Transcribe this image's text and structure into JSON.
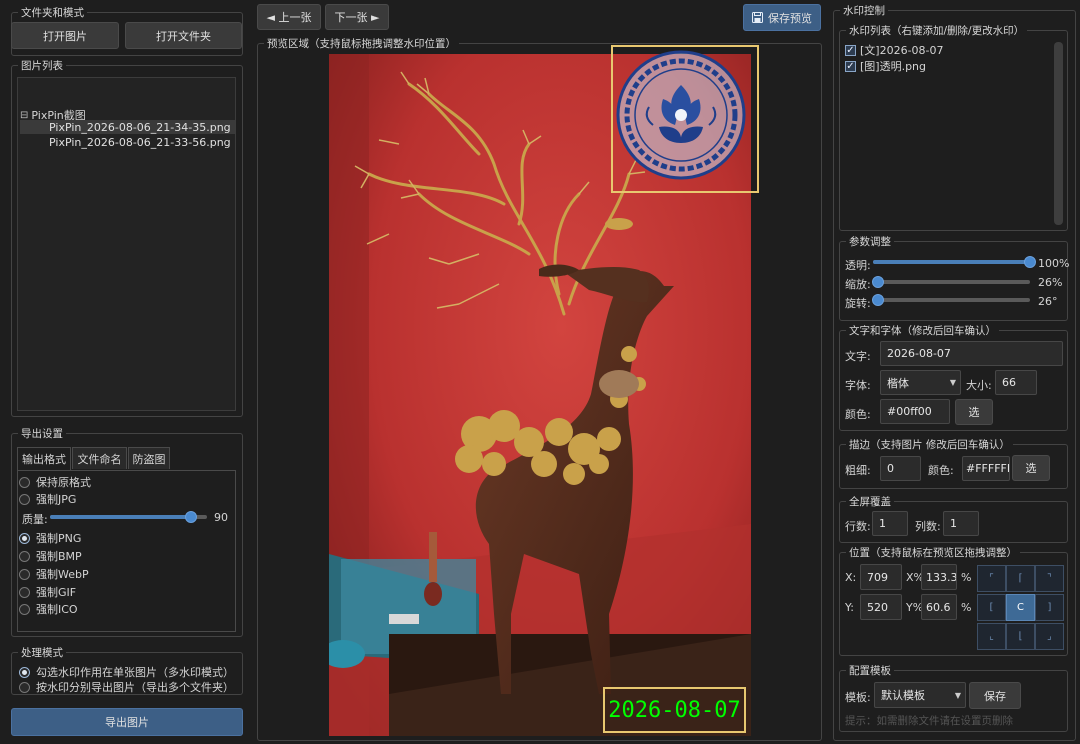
{
  "left": {
    "files_group": {
      "title": "文件夹和模式",
      "open_image": "打开图片",
      "open_folder": "打开文件夹"
    },
    "image_list": {
      "title": "图片列表",
      "folder": "PixPin截图",
      "folder_toggle": "⊟",
      "items": [
        "PixPin_2026-08-06_21-34-35.png",
        "PixPin_2026-08-06_21-33-56.png"
      ]
    },
    "export": {
      "title": "导出设置",
      "tabs": [
        "输出格式",
        "文件命名",
        "防盗图"
      ],
      "formats": [
        "保持原格式",
        "强制JPG",
        "强制PNG",
        "强制BMP",
        "强制WebP",
        "强制GIF",
        "强制ICO"
      ],
      "selected_format": "强制PNG",
      "quality_label": "质量:",
      "quality_value": "90",
      "quality_percent": 90
    },
    "mode": {
      "title": "处理模式",
      "options": [
        "勾选水印作用在单张图片（多水印模式）",
        "按水印分别导出图片（导出多个文件夹）"
      ],
      "selected": 0
    },
    "export_button": "导出图片"
  },
  "center": {
    "prev": "◄ 上一张",
    "next": "下一张 ►",
    "save_preview": "保存预览",
    "preview_title": "预览区域（支持鼠标拖拽调整水印位置）",
    "watermark_text": "2026-08-07",
    "watermark_text_color": "#00ff00"
  },
  "right": {
    "title": "水印控制",
    "wm_list": {
      "title": "水印列表（右键添加/删除/更改水印）",
      "items": [
        {
          "label": "[文]2026-08-07",
          "checked": true
        },
        {
          "label": "[图]透明.png",
          "checked": true
        }
      ]
    },
    "params": {
      "title": "参数调整",
      "opacity_label": "透明:",
      "opacity_value": "100%",
      "opacity_percent": 100,
      "scale_label": "缩放:",
      "scale_value": "26%",
      "scale_percent": 3,
      "rotate_label": "旋转:",
      "rotate_value": "26°",
      "rotate_percent": 3
    },
    "text_font": {
      "title": "文字和字体（修改后回车确认）",
      "text_label": "文字:",
      "text_value": "2026-08-07",
      "font_label": "字体:",
      "font_value": "楷体",
      "size_label": "大小:",
      "size_value": "66",
      "color_label": "颜色:",
      "color_value": "#00ff00",
      "pick_label": "选"
    },
    "stroke": {
      "title": "描边（支持图片 修改后回车确认）",
      "width_label": "粗细:",
      "width_value": "0",
      "color_label": "颜色:",
      "color_value": "#FFFFFF",
      "pick_label": "选"
    },
    "fullscreen": {
      "title": "全屏覆盖",
      "rows_label": "行数:",
      "rows_value": "1",
      "cols_label": "列数:",
      "cols_value": "1"
    },
    "position": {
      "title": "位置（支持鼠标在预览区拖拽调整）",
      "x_label": "X:",
      "x_value": "709",
      "xp_label": "X%",
      "xp_value": "133.3",
      "pct1": "%",
      "y_label": "Y:",
      "y_value": "520",
      "yp_label": "Y%",
      "yp_value": "60.6",
      "pct2": "%",
      "grid": [
        "⌜",
        "⌈",
        "⌝",
        "[",
        "C",
        "]",
        "⌞",
        "⌊",
        "⌟"
      ]
    },
    "template": {
      "title": "配置模板",
      "label": "模板:",
      "value": "默认模板",
      "save": "保存",
      "hint": "提示：如需删除文件请在设置页删除"
    }
  }
}
